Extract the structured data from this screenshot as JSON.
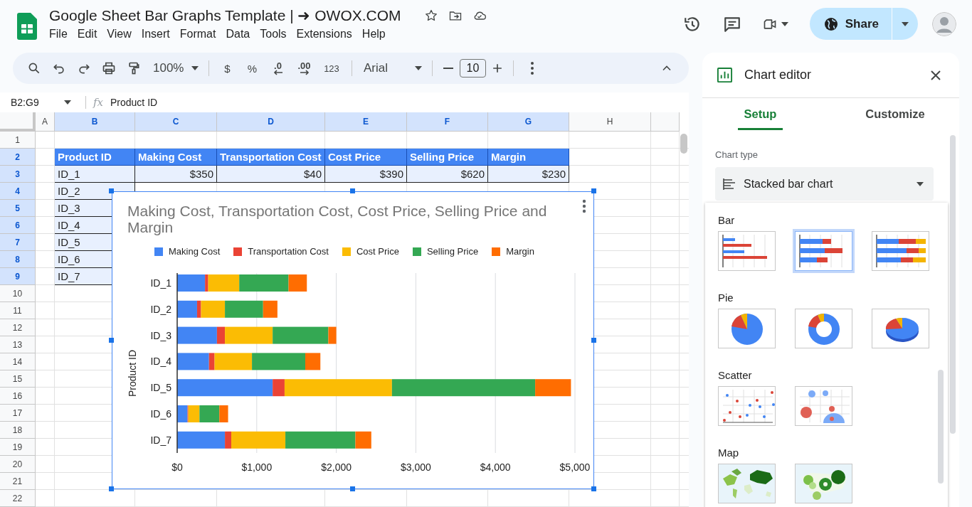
{
  "document": {
    "title": "Google Sheet Bar Graphs Template | ➜ OWOX.COM"
  },
  "menu": [
    "File",
    "Edit",
    "View",
    "Insert",
    "Format",
    "Data",
    "Tools",
    "Extensions",
    "Help"
  ],
  "share_button": {
    "label": "Share"
  },
  "toolbar": {
    "zoom": "100%",
    "currency": "$",
    "percent": "%",
    "decrease_decimal": ".0",
    "increase_decimal": ".00",
    "more_formats": "123",
    "font": "Arial",
    "font_size": "10"
  },
  "formula_bar": {
    "name_box": "B2:G9",
    "fx_label": "fx",
    "value": "Product ID"
  },
  "sheet": {
    "columns": [
      {
        "label": "A",
        "selected": false
      },
      {
        "label": "B",
        "selected": true
      },
      {
        "label": "C",
        "selected": true
      },
      {
        "label": "D",
        "selected": true
      },
      {
        "label": "E",
        "selected": true
      },
      {
        "label": "F",
        "selected": true
      },
      {
        "label": "G",
        "selected": true
      },
      {
        "label": "H",
        "selected": false
      }
    ],
    "row_numbers": [
      {
        "label": "1",
        "selected": false
      },
      {
        "label": "2",
        "selected": true
      },
      {
        "label": "3",
        "selected": true
      },
      {
        "label": "4",
        "selected": true
      },
      {
        "label": "5",
        "selected": true
      },
      {
        "label": "6",
        "selected": true
      },
      {
        "label": "7",
        "selected": true
      },
      {
        "label": "8",
        "selected": true
      },
      {
        "label": "9",
        "selected": true
      },
      {
        "label": "10",
        "selected": false
      },
      {
        "label": "11",
        "selected": false
      },
      {
        "label": "12",
        "selected": false
      },
      {
        "label": "13",
        "selected": false
      },
      {
        "label": "14",
        "selected": false
      },
      {
        "label": "15",
        "selected": false
      },
      {
        "label": "16",
        "selected": false
      },
      {
        "label": "17",
        "selected": false
      },
      {
        "label": "18",
        "selected": false
      },
      {
        "label": "19",
        "selected": false
      },
      {
        "label": "20",
        "selected": false
      },
      {
        "label": "21",
        "selected": false
      },
      {
        "label": "22",
        "selected": false
      }
    ],
    "table": {
      "header": [
        "Product ID",
        "Making Cost",
        "Transportation Cost",
        "Cost Price",
        "Selling Price",
        "Margin"
      ],
      "rows": [
        [
          "ID_1",
          "$350",
          "$40",
          "$390",
          "$620",
          "$230"
        ],
        [
          "ID_2"
        ],
        [
          "ID_3"
        ],
        [
          "ID_4"
        ],
        [
          "ID_5"
        ],
        [
          "ID_6"
        ],
        [
          "ID_7"
        ]
      ]
    }
  },
  "chart": {
    "chart_data": {
      "type": "bar",
      "orientation": "horizontal",
      "stacked": true,
      "grid": true,
      "legend": "top",
      "title": "Making Cost, Transportation Cost, Cost Price, Selling Price and Margin",
      "ylabel": "Product ID",
      "categories": [
        "ID_1",
        "ID_2",
        "ID_3",
        "ID_4",
        "ID_5",
        "ID_6",
        "ID_7"
      ],
      "series": [
        {
          "name": "Making Cost",
          "color": "#4285f4",
          "values": [
            350,
            250,
            500,
            400,
            1200,
            130,
            600
          ]
        },
        {
          "name": "Transportation Cost",
          "color": "#ea4335",
          "values": [
            40,
            50,
            100,
            70,
            150,
            10,
            80
          ]
        },
        {
          "name": "Cost Price",
          "color": "#fbbc04",
          "values": [
            390,
            300,
            600,
            470,
            1350,
            140,
            680
          ]
        },
        {
          "name": "Selling Price",
          "color": "#34a853",
          "values": [
            620,
            480,
            700,
            670,
            1800,
            250,
            880
          ]
        },
        {
          "name": "Margin",
          "color": "#ff6d01",
          "values": [
            230,
            180,
            100,
            190,
            450,
            110,
            200
          ]
        }
      ],
      "xlim": [
        0,
        5000
      ],
      "xticks": [
        {
          "value": 0,
          "label": "$0"
        },
        {
          "value": 1000,
          "label": "$1,000"
        },
        {
          "value": 2000,
          "label": "$2,000"
        },
        {
          "value": 3000,
          "label": "$3,000"
        },
        {
          "value": 4000,
          "label": "$4,000"
        },
        {
          "value": 5000,
          "label": "$5,000"
        }
      ]
    }
  },
  "chart_editor": {
    "title": "Chart editor",
    "tabs": [
      {
        "label": "Setup",
        "selected": true
      },
      {
        "label": "Customize",
        "selected": false
      }
    ],
    "chart_type_label": "Chart type",
    "chart_type": "Stacked bar chart",
    "groups": [
      {
        "label": "Bar",
        "options": [
          {
            "kind": "bar-clustered",
            "selected": false
          },
          {
            "kind": "bar-stacked",
            "selected": true
          },
          {
            "kind": "bar-100",
            "selected": false
          }
        ]
      },
      {
        "label": "Pie",
        "options": [
          {
            "kind": "pie",
            "selected": false
          },
          {
            "kind": "donut",
            "selected": false
          },
          {
            "kind": "pie-3d",
            "selected": false
          }
        ]
      },
      {
        "label": "Scatter",
        "options": [
          {
            "kind": "scatter",
            "selected": false
          },
          {
            "kind": "bubble",
            "selected": false
          }
        ]
      },
      {
        "label": "Map",
        "options": [
          {
            "kind": "geo",
            "selected": false
          },
          {
            "kind": "geo-bubble",
            "selected": false
          }
        ]
      }
    ]
  }
}
